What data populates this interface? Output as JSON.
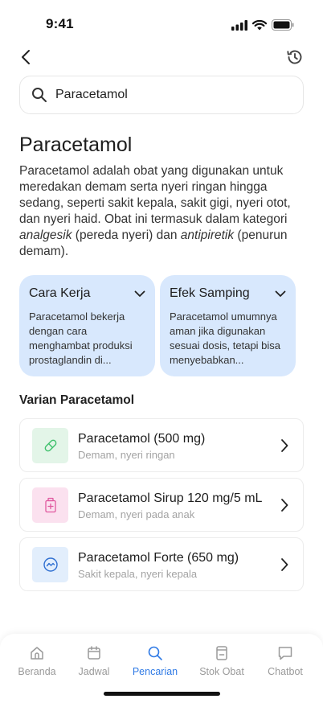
{
  "status_bar": {
    "time": "9:41"
  },
  "search": {
    "value": "Paracetamol"
  },
  "drug": {
    "title": "Paracetamol",
    "description_part1": "Paracetamol adalah obat yang digunakan untuk meredakan demam serta nyeri ringan hingga sedang, seperti sakit kepala, sakit gigi, nyeri otot, dan nyeri haid. Obat ini termasuk dalam kategori ",
    "description_em1": "analgesik",
    "description_part2": " (pereda nyeri) dan ",
    "description_em2": "antipiretik",
    "description_part3": " (penurun demam)."
  },
  "cards": [
    {
      "title": "Cara Kerja",
      "body": "Paracetamol bekerja dengan cara menghambat produksi prostaglandin di..."
    },
    {
      "title": "Efek Samping",
      "body": "Paracetamol umumnya aman jika digunakan sesuai dosis, tetapi bisa menyebabkan..."
    }
  ],
  "variants_section": {
    "title": "Varian Paracetamol"
  },
  "variants": [
    {
      "name": "Paracetamol (500 mg)",
      "sub": "Demam, nyeri ringan",
      "icon": "pill-icon",
      "thumb_bg": "#e3f5e8",
      "icon_color": "#3ec06b"
    },
    {
      "name": "Paracetamol Sirup 120 mg/5 mL",
      "sub": "Demam, nyeri pada anak",
      "icon": "syrup-bottle-icon",
      "thumb_bg": "#fbe1ef",
      "icon_color": "#e0589f"
    },
    {
      "name": "Paracetamol Forte (650 mg)",
      "sub": "Sakit kepala, nyeri kepala",
      "icon": "tablet-icon",
      "thumb_bg": "#e2eefc",
      "icon_color": "#2f6fd1"
    }
  ],
  "bottom_nav": [
    {
      "label": "Beranda",
      "icon": "home-icon",
      "active": false
    },
    {
      "label": "Jadwal",
      "icon": "calendar-icon",
      "active": false
    },
    {
      "label": "Pencarian",
      "icon": "search-icon",
      "active": true
    },
    {
      "label": "Stok Obat",
      "icon": "medicine-box-icon",
      "active": false
    },
    {
      "label": "Chatbot",
      "icon": "chat-icon",
      "active": false
    }
  ],
  "colors": {
    "accent": "#2f7ae5",
    "card_bg": "#d8e8fd",
    "muted": "#9a9a9a"
  }
}
